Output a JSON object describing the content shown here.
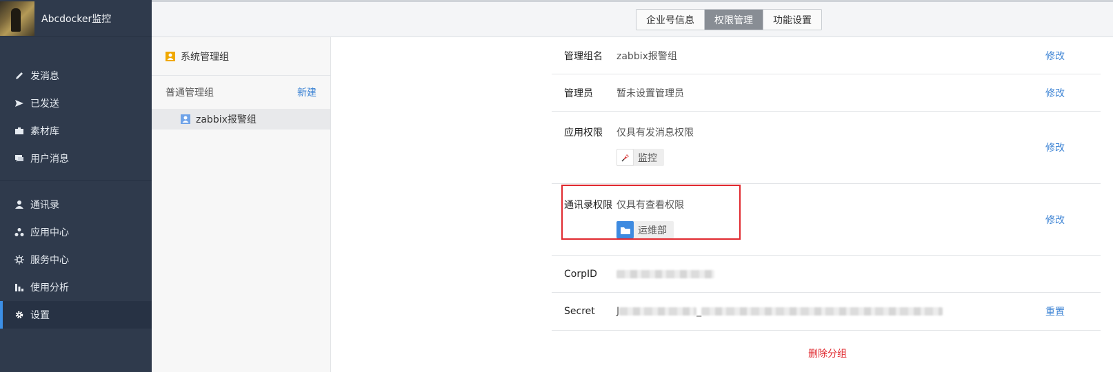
{
  "brand": {
    "name": "Abcdocker监控"
  },
  "nav": {
    "group1": [
      {
        "id": "send",
        "label": "发消息",
        "icon": "pencil-icon"
      },
      {
        "id": "sent",
        "label": "已发送",
        "icon": "send-icon"
      },
      {
        "id": "material",
        "label": "素材库",
        "icon": "briefcase-icon"
      },
      {
        "id": "user-msg",
        "label": "用户消息",
        "icon": "chat-icon"
      }
    ],
    "group2": [
      {
        "id": "contacts",
        "label": "通讯录",
        "icon": "person-icon"
      },
      {
        "id": "apps",
        "label": "应用中心",
        "icon": "apps-icon"
      },
      {
        "id": "service",
        "label": "服务中心",
        "icon": "chip-icon"
      },
      {
        "id": "analytics",
        "label": "使用分析",
        "icon": "bar-chart-icon"
      },
      {
        "id": "settings",
        "label": "设置",
        "icon": "gear-icon",
        "active": true
      }
    ]
  },
  "tabs": [
    {
      "label": "企业号信息"
    },
    {
      "label": "权限管理",
      "active": true
    },
    {
      "label": "功能设置"
    }
  ],
  "groups": {
    "system": "系统管理组",
    "normal_title": "普通管理组",
    "new_label": "新建",
    "items": [
      {
        "label": "zabbix报警组"
      }
    ]
  },
  "detail": {
    "group_name_label": "管理组名",
    "group_name_value": "zabbix报警组",
    "admin_label": "管理员",
    "admin_value": "暂未设置管理员",
    "app_perm_label": "应用权限",
    "app_perm_value": "仅具有发消息权限",
    "app_chip": "监控",
    "contact_perm_label": "通讯录权限",
    "contact_perm_value": "仅具有查看权限",
    "contact_chip": "运维部",
    "corpid_label": "CorpID",
    "secret_label": "Secret",
    "secret_prefix": "J",
    "secret_sep": "_",
    "edit_label": "修改",
    "reset_label": "重置",
    "delete_label": "删除分组"
  },
  "colors": {
    "sidebar": "#2f3a4c",
    "accent": "#3c83d4",
    "danger": "#e0282e"
  }
}
